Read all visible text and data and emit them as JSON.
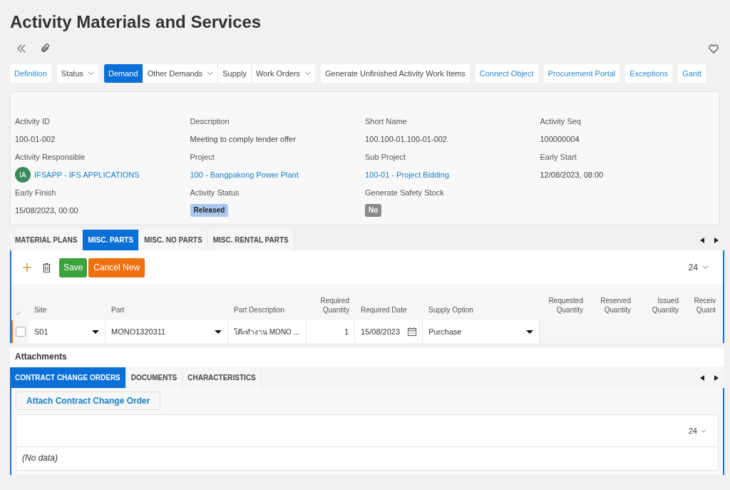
{
  "title": "Activity Materials and Services",
  "toolbar_groups": [
    [
      {
        "label": "Definition",
        "kind": "link",
        "selected": false
      }
    ],
    [
      {
        "label": "Status",
        "kind": "menu",
        "selected": false
      }
    ],
    [
      {
        "label": "Demand",
        "kind": "action",
        "selected": true
      },
      {
        "label": "Other Demands",
        "kind": "menu",
        "selected": false
      },
      {
        "label": "Supply",
        "kind": "action",
        "selected": false
      },
      {
        "label": "Work Orders",
        "kind": "menu",
        "selected": false
      }
    ],
    [
      {
        "label": "Generate Unfinished Activity Work Items",
        "kind": "action",
        "selected": false
      }
    ],
    [
      {
        "label": "Connect Object",
        "kind": "link",
        "selected": false
      }
    ],
    [
      {
        "label": "Procurement Portal",
        "kind": "link",
        "selected": false
      }
    ],
    [
      {
        "label": "Exceptions",
        "kind": "link",
        "selected": false
      }
    ],
    [
      {
        "label": "Gantt",
        "kind": "link",
        "selected": false
      }
    ]
  ],
  "fields": [
    {
      "label": "Activity ID",
      "value": "100-01-002",
      "kind": "text"
    },
    {
      "label": "Description",
      "value": "Meeting to comply tender offer",
      "kind": "text"
    },
    {
      "label": "Short Name",
      "value": "100.100-01.100-01-002",
      "kind": "text"
    },
    {
      "label": "Activity Seq",
      "value": "100000004",
      "kind": "text"
    },
    {
      "label": "Activity Responsible",
      "value": "IFSAPP - IFS APPLICATIONS",
      "avatar": "IA",
      "kind": "avatar-link"
    },
    {
      "label": "Project",
      "value": "100 - Bangpakong Power Plant",
      "kind": "link"
    },
    {
      "label": "Sub Project",
      "value": "100-01 - Project Bidding",
      "kind": "link"
    },
    {
      "label": "Early Start",
      "value": "12/08/2023, 08:00",
      "kind": "text"
    },
    {
      "label": "Early Finish",
      "value": "15/08/2023, 00:00",
      "kind": "text"
    },
    {
      "label": "Activity Status",
      "value": "Released",
      "kind": "badge",
      "color": "#a9c8f0"
    },
    {
      "label": "Generate Safety Stock",
      "value": "No",
      "kind": "badge",
      "color": "#8a8a8a"
    }
  ],
  "tabs": [
    {
      "label": "MATERIAL PLANS",
      "selected": false
    },
    {
      "label": "MISC. PARTS",
      "selected": true
    },
    {
      "label": "MISC. NO PARTS",
      "selected": false
    },
    {
      "label": "MISC. RENTAL PARTS",
      "selected": false
    }
  ],
  "parts_toolbar": {
    "save": "Save",
    "cancel": "Cancel New",
    "page_size": "24"
  },
  "table": {
    "columns": [
      "Site",
      "Part",
      "Part Description",
      "Required Quantity",
      "Required Date",
      "Supply Option",
      "Requested Quantity",
      "Reserved Quantity",
      "Issued Quantity",
      "Receiv Quant"
    ],
    "rows": [
      {
        "checked": false,
        "cells": [
          "S01",
          "MONO1320311",
          "โต๊ะทำงาน MONO ...",
          "1",
          "15/08/2023",
          "Purchase",
          "",
          "",
          "",
          ""
        ]
      }
    ]
  },
  "attachments": {
    "title": "Attachments",
    "tabs": [
      {
        "label": "CONTRACT CHANGE ORDERS",
        "selected": true
      },
      {
        "label": "DOCUMENTS",
        "selected": false
      },
      {
        "label": "CHARACTERISTICS",
        "selected": false
      }
    ],
    "button": "Attach Contract Change Order",
    "page_size": "24",
    "empty": "(No data)"
  }
}
